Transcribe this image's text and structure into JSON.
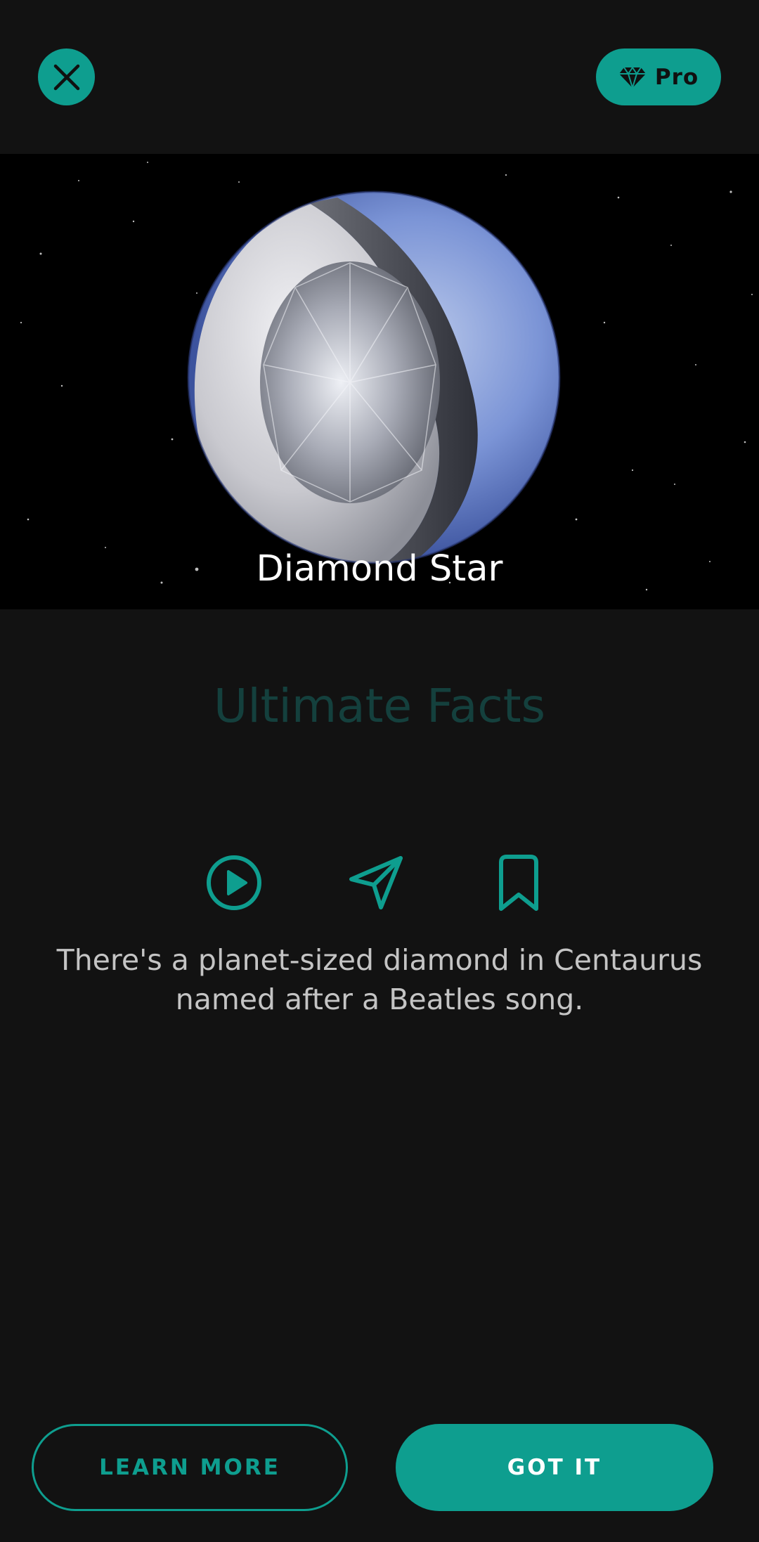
{
  "header": {
    "close_icon": "close-icon",
    "pro_icon": "diamond-icon",
    "pro_label": "Pro"
  },
  "hero": {
    "image": "diamond-planet-cutaway",
    "caption": "Diamond Star"
  },
  "section": {
    "title": "Ultimate Facts"
  },
  "actions": [
    {
      "icon": "play-circle-icon"
    },
    {
      "icon": "send-icon"
    },
    {
      "icon": "bookmark-icon"
    }
  ],
  "fact": {
    "text": "There's a planet-sized diamond in Centaurus named after a Beatles song."
  },
  "buttons": {
    "learn_more": "LEARN MORE",
    "got_it": "GOT IT"
  },
  "colors": {
    "accent": "#0e9e8f",
    "background": "#121212",
    "title_dim": "#14403d",
    "body_text": "#c4c4c4"
  }
}
